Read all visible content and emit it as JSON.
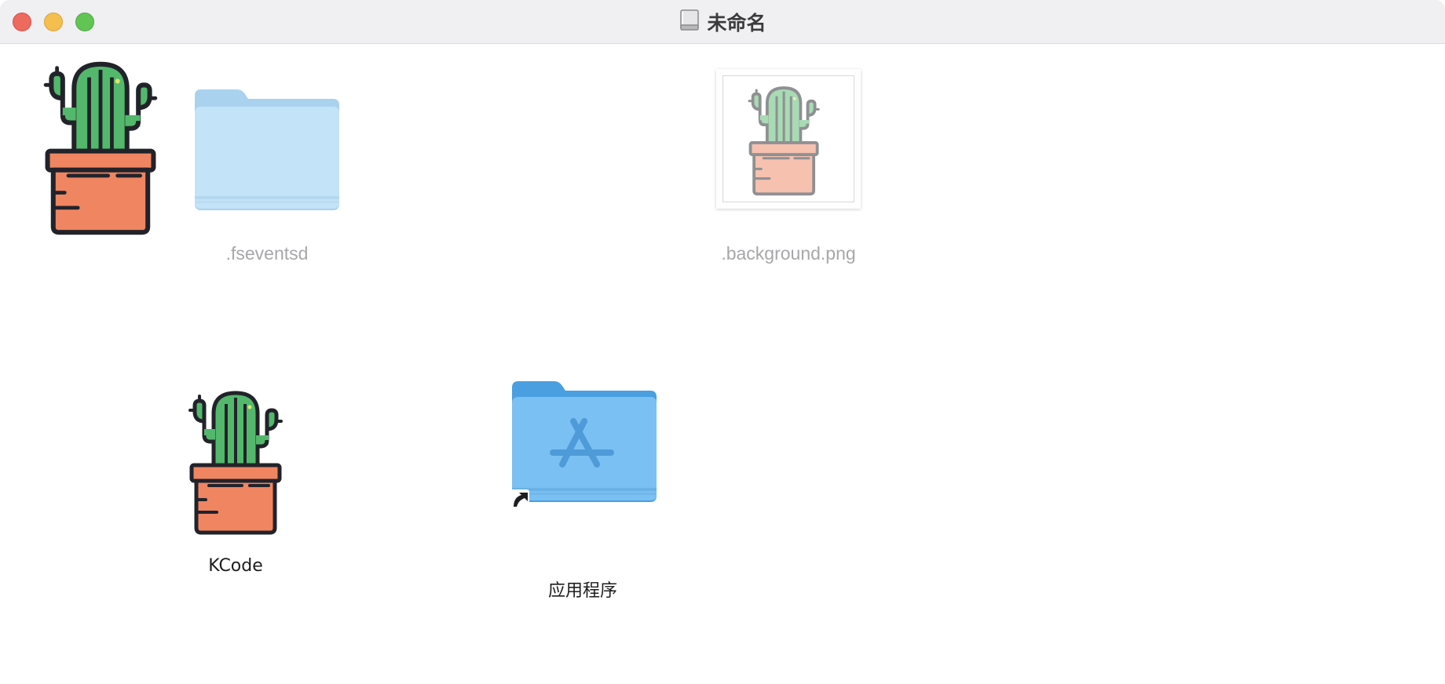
{
  "window": {
    "title": "未命名",
    "title_icon": "disk-icon"
  },
  "items": {
    "fseventsd": {
      "label": ".fseventsd",
      "icon": "folder-icon"
    },
    "background": {
      "label": ".background.png",
      "icon": "image-thumbnail"
    },
    "kcode": {
      "label": "KCode",
      "icon": "cactus-app-icon"
    },
    "applications": {
      "label": "应用程序",
      "icon": "applications-folder-alias-icon"
    },
    "volume_icon": {
      "icon": "cactus-volume-icon"
    }
  },
  "colors": {
    "cactus_green": "#53b86c",
    "pot_orange": "#f08562",
    "outline": "#22232a",
    "folder_light": "#c2e3f8",
    "folder_blue": "#7ac0f2",
    "titlebar": "#f0eff2"
  }
}
